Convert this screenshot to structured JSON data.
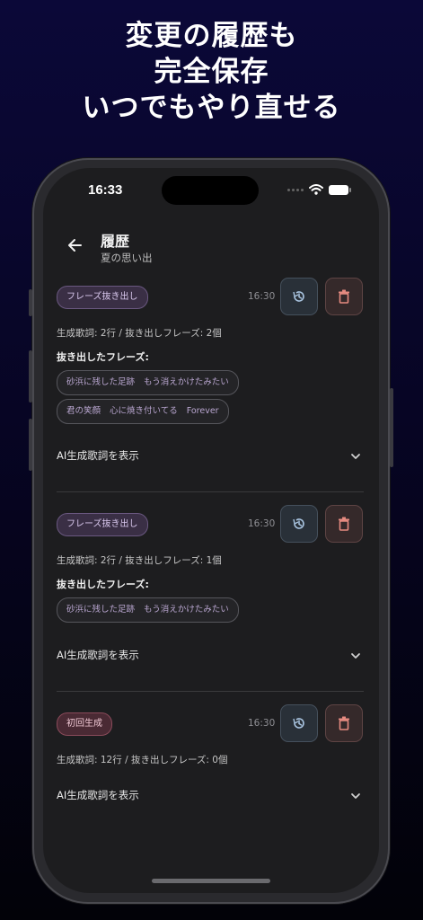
{
  "promo": {
    "line1": "変更の履歴も",
    "line2": "完全保存",
    "line3": "いつでもやり直せる"
  },
  "status_bar": {
    "time": "16:33"
  },
  "header": {
    "title": "履歴",
    "subtitle": "夏の思い出"
  },
  "icons": {
    "back": "arrow-left-icon",
    "restore": "history-restore-icon",
    "delete": "trash-icon",
    "expand": "chevron-down-icon"
  },
  "colors": {
    "background": "#1d1d1f",
    "badge_purple": "#3a2f45",
    "badge_pink": "#4a2a34",
    "restore_button": "#293038",
    "delete_button": "#35292a"
  },
  "entries": [
    {
      "badge": "フレーズ抜き出し",
      "time": "16:30",
      "stats": "生成歌詞: 2行 / 抜き出しフレーズ: 2個",
      "phrases_label": "抜き出したフレーズ:",
      "phrases": [
        [
          "砂浜に残した足跡",
          "もう消えかけたみたい"
        ],
        [
          "君の笑顔",
          "心に焼き付いてる",
          "Forever"
        ]
      ],
      "ai_toggle": "AI生成歌詞を表示"
    },
    {
      "badge": "フレーズ抜き出し",
      "time": "16:30",
      "stats": "生成歌詞: 2行 / 抜き出しフレーズ: 1個",
      "phrases_label": "抜き出したフレーズ:",
      "phrases": [
        [
          "砂浜に残した足跡",
          "もう消えかけたみたい"
        ]
      ],
      "ai_toggle": "AI生成歌詞を表示"
    },
    {
      "badge": "初回生成",
      "time": "16:30",
      "stats": "生成歌詞: 12行 / 抜き出しフレーズ: 0個",
      "ai_toggle": "AI生成歌詞を表示"
    }
  ]
}
